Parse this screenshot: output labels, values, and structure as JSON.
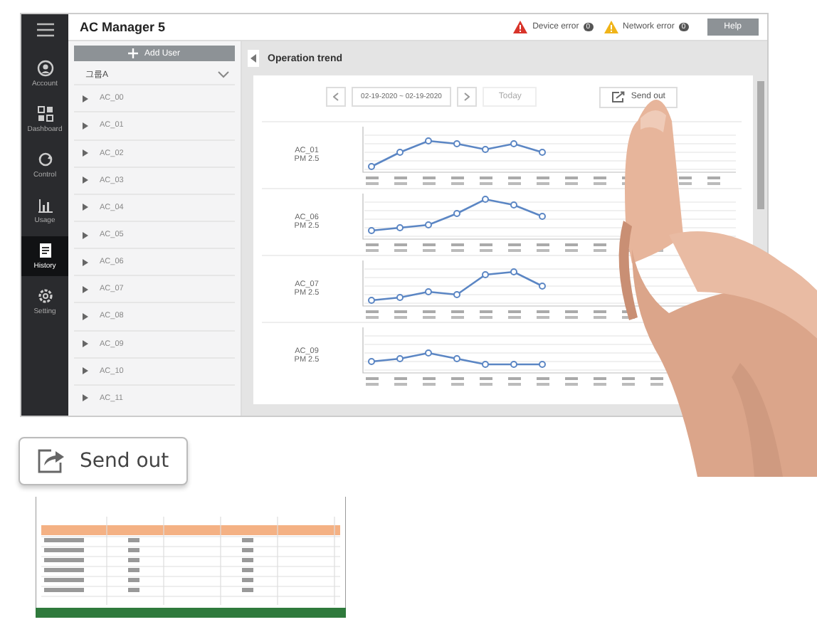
{
  "app": {
    "title": "AC Manager 5",
    "help": "Help"
  },
  "alerts": [
    {
      "label": "Device error",
      "count": "0",
      "color": "#d8342a"
    },
    {
      "label": "Network error",
      "count": "0",
      "color": "#f0b419"
    }
  ],
  "nav": [
    {
      "label": "Account",
      "kind": "account",
      "selected": false
    },
    {
      "label": "Dashboard",
      "kind": "dashboard",
      "selected": false
    },
    {
      "label": "Control",
      "kind": "control",
      "selected": false
    },
    {
      "label": "Usage",
      "kind": "usage",
      "selected": false
    },
    {
      "label": "History",
      "kind": "history",
      "selected": true
    },
    {
      "label": "Setting",
      "kind": "setting",
      "selected": false
    }
  ],
  "units": {
    "add_button": "Add User",
    "group": "그룹A",
    "items": [
      "AC_00",
      "AC_01",
      "AC_02",
      "AC_03",
      "AC_04",
      "AC_05",
      "AC_06",
      "AC_07",
      "AC_08",
      "AC_09",
      "AC_10",
      "AC_11"
    ]
  },
  "trend": {
    "title": "Operation trend",
    "date_range": "02-19-2020 ~ 02-19-2020",
    "today": "Today",
    "send_out": "Send out",
    "rows": [
      {
        "unit": "AC_01",
        "metric": "PM 2.5"
      },
      {
        "unit": "AC_06",
        "metric": "PM 2.5"
      },
      {
        "unit": "AC_07",
        "metric": "PM 2.5"
      },
      {
        "unit": "AC_09",
        "metric": "PM 2.5"
      }
    ]
  },
  "callout": {
    "label": "Send out"
  }
}
